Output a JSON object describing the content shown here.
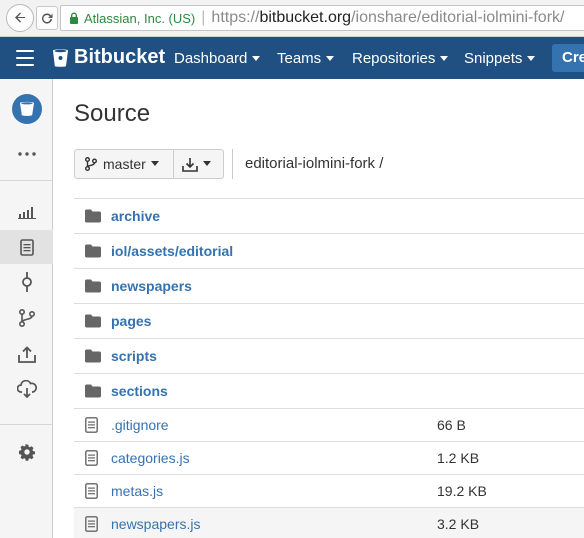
{
  "browser": {
    "ev_label": "Atlassian, Inc. (US)",
    "url_proto": "https://",
    "url_host": "bitbucket.org",
    "url_path": "/ionshare/editorial-iolmini-fork/"
  },
  "topnav": {
    "brand": "Bitbucket",
    "items": [
      "Dashboard",
      "Teams",
      "Repositories",
      "Snippets"
    ],
    "create_label": "Cre"
  },
  "page": {
    "title": "Source",
    "branch_label": "master",
    "breadcrumb": "editorial-iolmini-fork /"
  },
  "files": [
    {
      "name": "archive",
      "type": "dir",
      "size": ""
    },
    {
      "name": "iol/assets/editorial",
      "type": "dir",
      "size": ""
    },
    {
      "name": "newspapers",
      "type": "dir",
      "size": ""
    },
    {
      "name": "pages",
      "type": "dir",
      "size": ""
    },
    {
      "name": "scripts",
      "type": "dir",
      "size": ""
    },
    {
      "name": "sections",
      "type": "dir",
      "size": ""
    },
    {
      "name": ".gitignore",
      "type": "file",
      "size": "66 B"
    },
    {
      "name": "categories.js",
      "type": "file",
      "size": "1.2 KB"
    },
    {
      "name": "metas.js",
      "type": "file",
      "size": "19.2 KB"
    },
    {
      "name": "newspapers.js",
      "type": "file",
      "size": "3.2 KB"
    }
  ],
  "sidebar": {
    "items": [
      "repo-avatar-icon",
      "more-icon",
      "overview-icon",
      "source-icon",
      "commits-icon",
      "branches-icon",
      "pull-requests-icon",
      "downloads-icon",
      "settings-icon"
    ]
  },
  "colors": {
    "nav_bg": "#205081",
    "link": "#3572b0",
    "create_btn": "#3572b0"
  }
}
